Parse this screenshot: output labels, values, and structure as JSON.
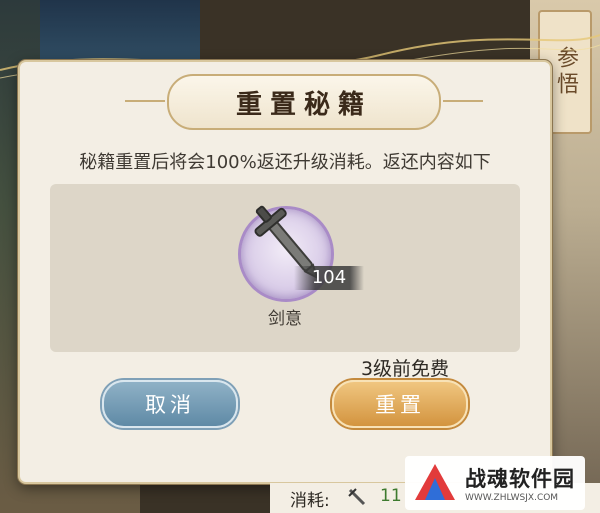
{
  "dialog": {
    "title": "重置秘籍",
    "message": "秘籍重置后将会100%返还升级消耗。返还内容如下",
    "reward": {
      "icon": "sword-icon",
      "count": "104",
      "name": "剑意"
    },
    "free_note": "3级前免费",
    "cancel_label": "取消",
    "reset_label": "重置"
  },
  "background": {
    "side_card_text": "参悟"
  },
  "footer": {
    "cost_label": "消耗:",
    "cost_value": "11"
  },
  "watermark": {
    "name": "战魂软件园",
    "url": "WWW.ZHLWSJX.COM"
  },
  "colors": {
    "cancel_button": "#6f97b1",
    "reset_button": "#e0a957",
    "dialog_bg": "#f3eee4",
    "panel_bg": "#ddd6c8"
  }
}
